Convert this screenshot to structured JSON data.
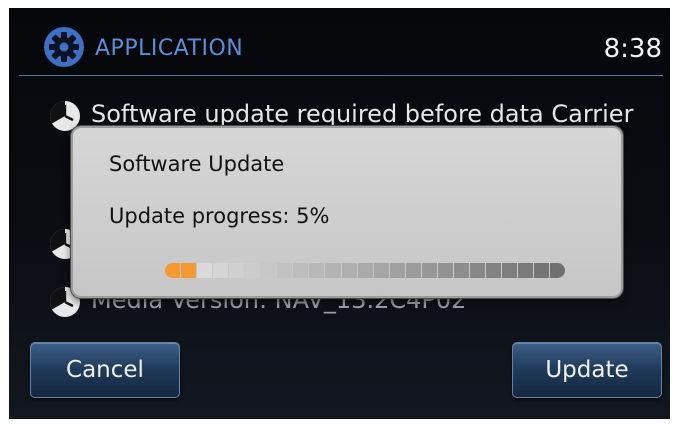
{
  "header": {
    "icon": "gear-icon",
    "title": "APPLICATION",
    "time": "8:38"
  },
  "info_list": [
    {
      "icon": "clock-icon",
      "text": "Software update required before data Carrier"
    },
    {
      "icon": "clock-icon",
      "text": ""
    },
    {
      "icon": "clock-icon",
      "text": "Media Version: NAV_13.2C4P02"
    }
  ],
  "dialog": {
    "title": "Software Update",
    "progress_text": "Update progress: 5%",
    "progress": 0.05
  },
  "buttons": {
    "cancel_label": "Cancel",
    "update_label": "Update"
  },
  "colors": {
    "title_blue": "#5a8fd8",
    "progress_fill": "#f39a33",
    "progress_empty_light": "#dadada",
    "progress_empty_dark": "#707070",
    "button_blue": "#2a4a70"
  }
}
